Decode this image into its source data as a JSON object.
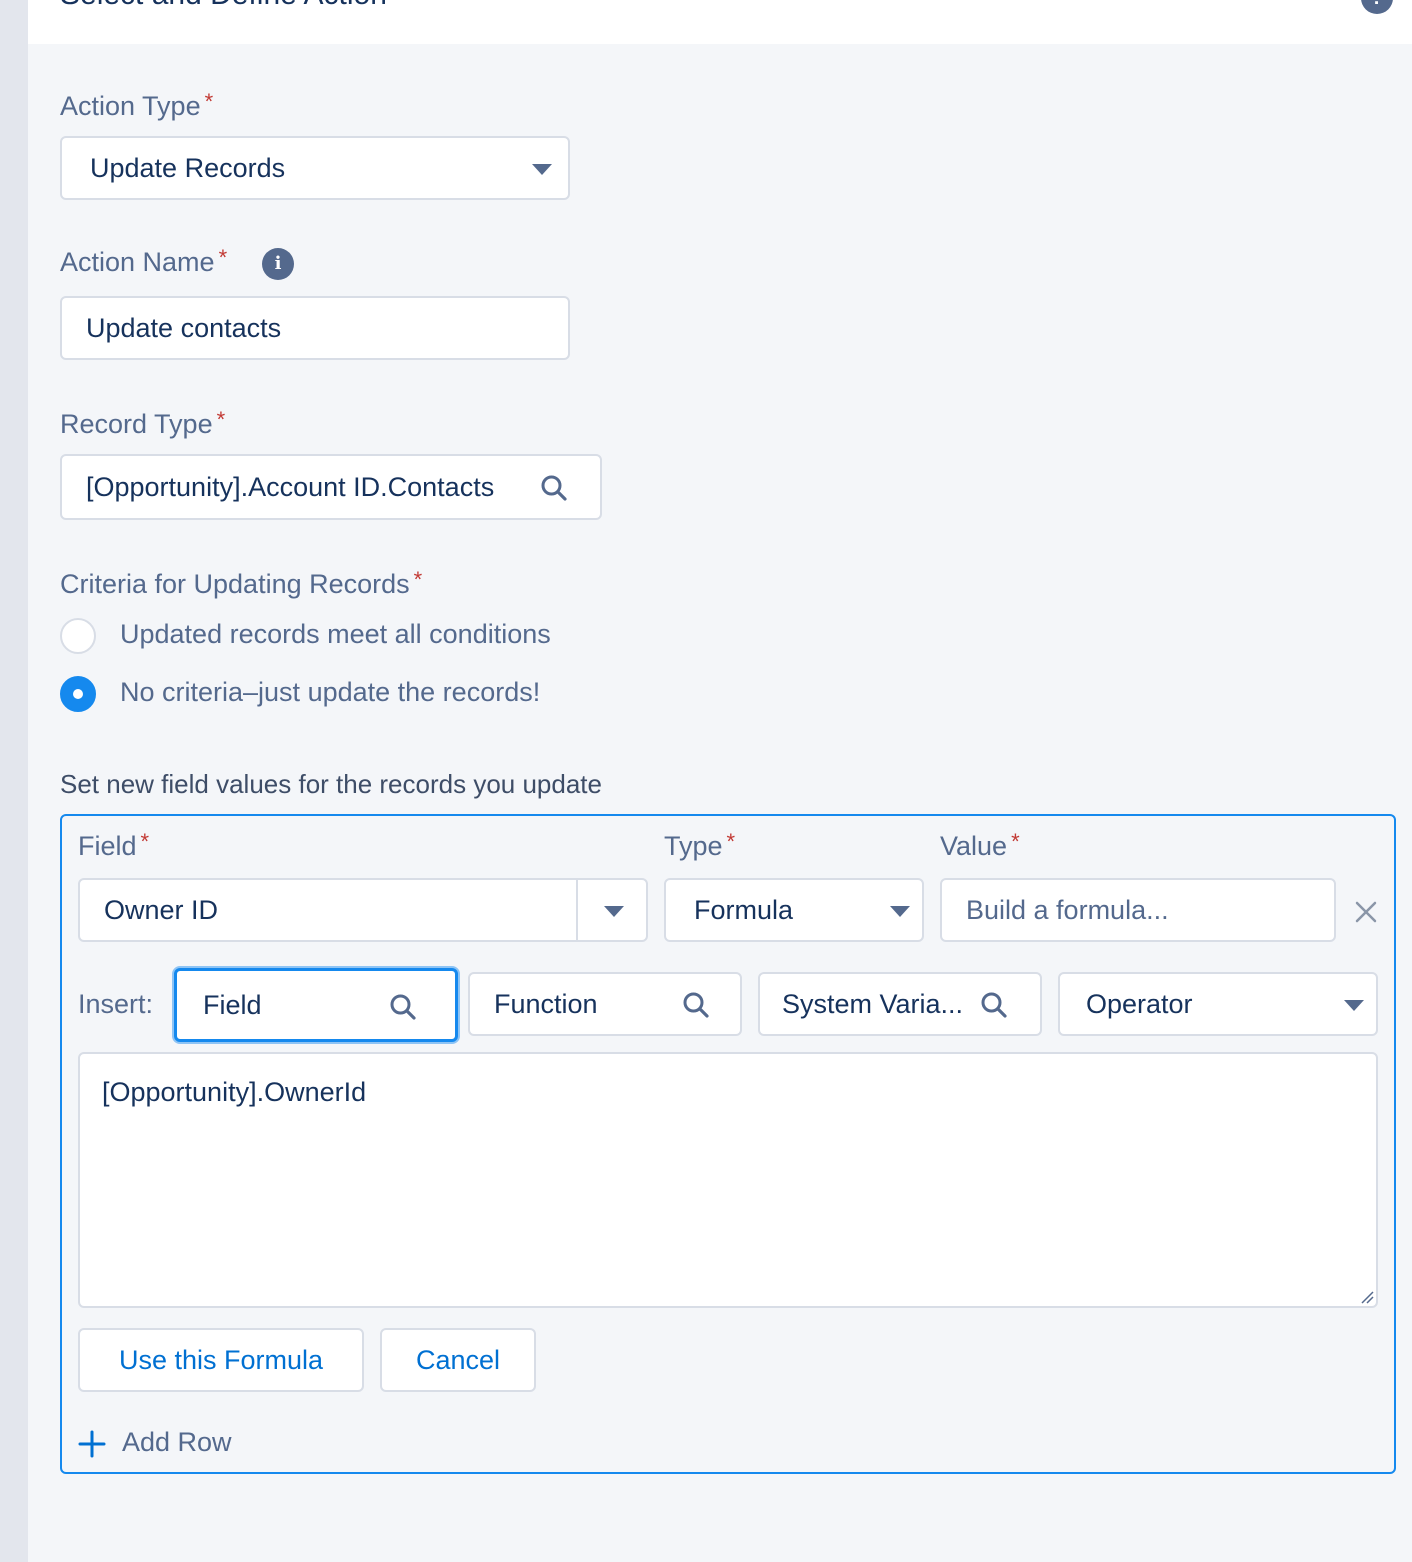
{
  "panel": {
    "title": "Select and Define Action",
    "help_icon": "help-icon"
  },
  "action_type": {
    "label": "Action Type",
    "required_mark": "*",
    "value": "Update Records"
  },
  "action_name": {
    "label": "Action Name",
    "required_mark": "*",
    "info_icon": "info-icon",
    "value": "Update contacts"
  },
  "record_type": {
    "label": "Record Type",
    "required_mark": "*",
    "value": "[Opportunity].Account ID.Contacts"
  },
  "criteria": {
    "label": "Criteria for Updating Records",
    "required_mark": "*",
    "options": [
      {
        "label": "Updated records meet all conditions",
        "selected": false
      },
      {
        "label": "No criteria–just update the records!",
        "selected": true
      }
    ]
  },
  "field_values": {
    "heading": "Set new field values for the records you update",
    "columns": {
      "field": "Field",
      "type": "Type",
      "value": "Value",
      "required_mark": "*"
    },
    "row": {
      "field": "Owner ID",
      "type": "Formula",
      "value_placeholder": "Build a formula..."
    },
    "insert": {
      "label": "Insert:",
      "field_placeholder": "Field",
      "function_placeholder": "Function",
      "system_variable_placeholder": "System Varia...",
      "operator_label": "Operator"
    },
    "formula_text": "[Opportunity].OwnerId",
    "use_formula_label": "Use this Formula",
    "cancel_label": "Cancel",
    "add_row_label": "Add Row"
  },
  "colors": {
    "accent": "#1589ee",
    "link": "#0070d2",
    "required": "#c23934",
    "label": "#54698d",
    "text": "#16325c",
    "border": "#d8dde6"
  }
}
